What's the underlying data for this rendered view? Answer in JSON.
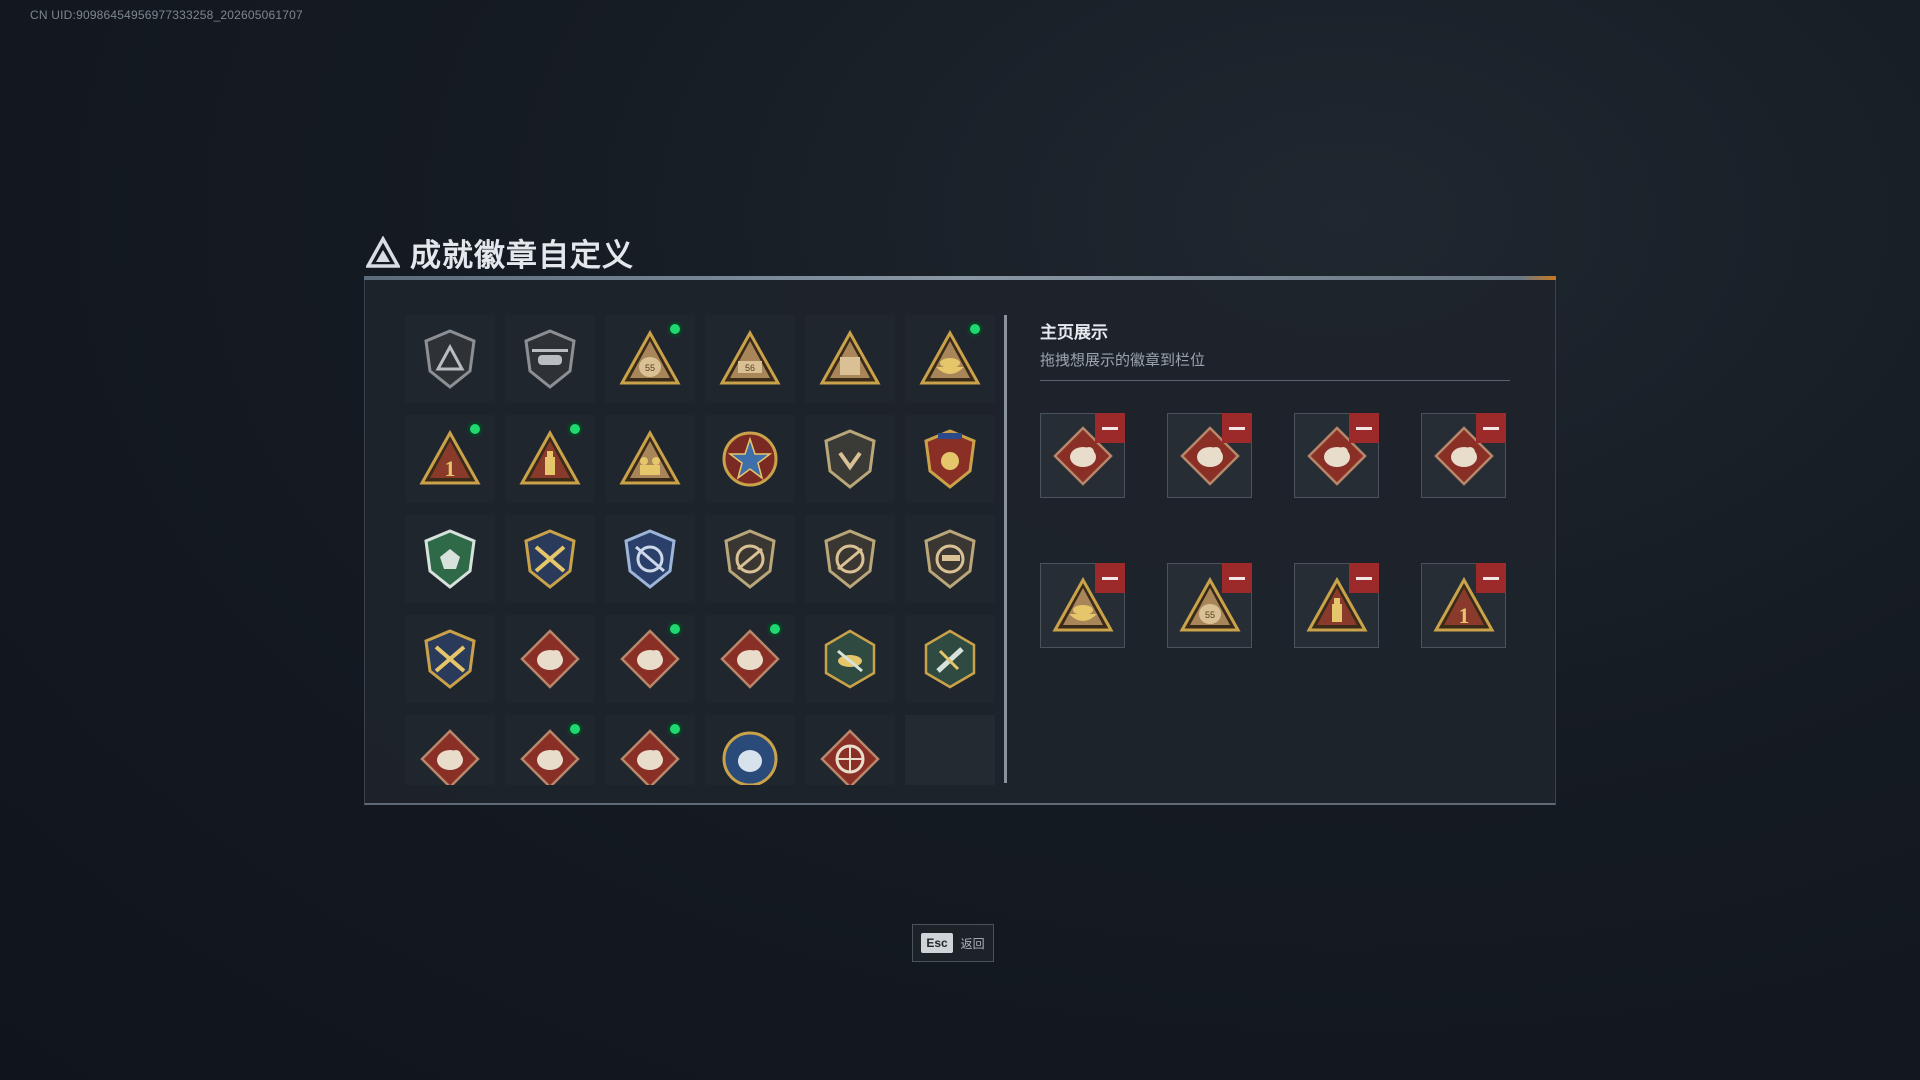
{
  "uid_text": "CN UID:90986454956977333258_202605061707",
  "title": "成就徽章自定义",
  "showcase": {
    "title": "主页展示",
    "subtitle": "拖拽想展示的徽章到栏位",
    "slots": [
      {
        "badge": "ram-bandit-badge"
      },
      {
        "badge": "ram-charge-badge"
      },
      {
        "badge": "wolf-roar-badge"
      },
      {
        "badge": "dragon-head-badge"
      },
      {
        "badge": "golden-bowl-badge"
      },
      {
        "badge": "sack-55-badge"
      },
      {
        "badge": "bottle-badge"
      },
      {
        "badge": "number-1-badge"
      }
    ]
  },
  "badges": [
    {
      "icon": "triangle-shield-badge",
      "is_new": false
    },
    {
      "icon": "helicopter-shield-badge",
      "is_new": false
    },
    {
      "icon": "sack-55-badge",
      "is_new": true
    },
    {
      "icon": "plate-56-badge",
      "is_new": false
    },
    {
      "icon": "crate-badge",
      "is_new": false
    },
    {
      "icon": "golden-bowl-badge",
      "is_new": true
    },
    {
      "icon": "number-1-badge",
      "is_new": true
    },
    {
      "icon": "bottle-badge",
      "is_new": true
    },
    {
      "icon": "soldiers-badge",
      "is_new": false
    },
    {
      "icon": "star-medal-badge",
      "is_new": false
    },
    {
      "icon": "shield-emblem-badge",
      "is_new": false
    },
    {
      "icon": "crowned-crest-badge",
      "is_new": false
    },
    {
      "icon": "green-crest-badge",
      "is_new": false
    },
    {
      "icon": "gold-crossed-rifles-badge",
      "is_new": false
    },
    {
      "icon": "blue-crossed-rifles-badge",
      "is_new": false
    },
    {
      "icon": "rifle-shield-badge",
      "is_new": false
    },
    {
      "icon": "rifle-shield-badge-2",
      "is_new": false
    },
    {
      "icon": "pistol-shield-badge",
      "is_new": false
    },
    {
      "icon": "gold-crossed-rifles-badge-2",
      "is_new": false
    },
    {
      "icon": "wolf-badge",
      "is_new": false
    },
    {
      "icon": "wolf-roar-badge",
      "is_new": true
    },
    {
      "icon": "ram-charge-badge",
      "is_new": true
    },
    {
      "icon": "wasp-hex-badge",
      "is_new": false
    },
    {
      "icon": "tools-hex-badge",
      "is_new": false
    },
    {
      "icon": "dragon-head-badge",
      "is_new": false
    },
    {
      "icon": "dragon-head-badge-2",
      "is_new": true
    },
    {
      "icon": "ram-bandit-badge",
      "is_new": true
    },
    {
      "icon": "blue-wolf-badge",
      "is_new": false
    },
    {
      "icon": "wheel-badge",
      "is_new": false
    },
    {
      "icon": "",
      "is_new": false
    }
  ],
  "esc": {
    "key": "Esc",
    "label": "返回"
  },
  "colors": {
    "gold": "#c9a24a",
    "red": "#8a2f26",
    "green_dot": "#1fd870",
    "remove": "#9d2a2a"
  }
}
